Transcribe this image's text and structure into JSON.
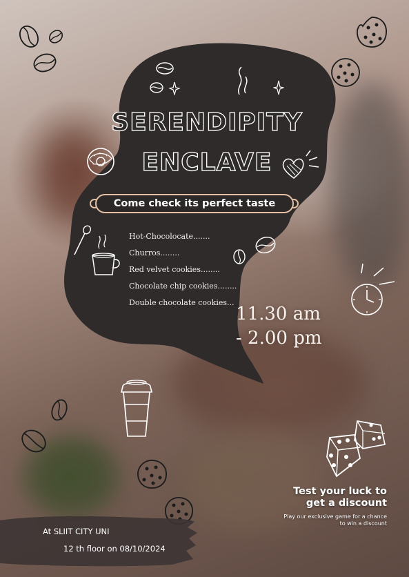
{
  "poster": {
    "title_line1": "SERENDIPITY",
    "title_line2": "ENCLAVE",
    "tagline": "Come check its perfect taste",
    "menu_items": [
      "Hot-Chocolocate.......",
      "Churros........",
      "Red velvet cookies........",
      "Chocolate chip cookies........",
      "Double chocolate cookies..."
    ],
    "hours_line1": "11.30 am",
    "hours_line2": "- 2.00 pm",
    "promo_title_line1": "Test your luck to",
    "promo_title_line2": "get a discount",
    "promo_sub_line1": "Play our exclusive game for a chance",
    "promo_sub_line2": "to win a discount",
    "location_line1": "At SLIIT CITY UNI",
    "location_line2": "12 th floor on 08/10/2024"
  },
  "colors": {
    "bubble": "#2f2b2b",
    "tagline_border": "#e5c0a3",
    "text_light": "#ffffff"
  },
  "icons": [
    "coffee-bean-icon",
    "cookie-icon",
    "donut-icon",
    "heart-icon",
    "sparkle-icon",
    "steam-icon",
    "spoon-icon",
    "coffee-cup-icon",
    "clock-icon",
    "takeaway-cup-icon",
    "dice-icon"
  ]
}
